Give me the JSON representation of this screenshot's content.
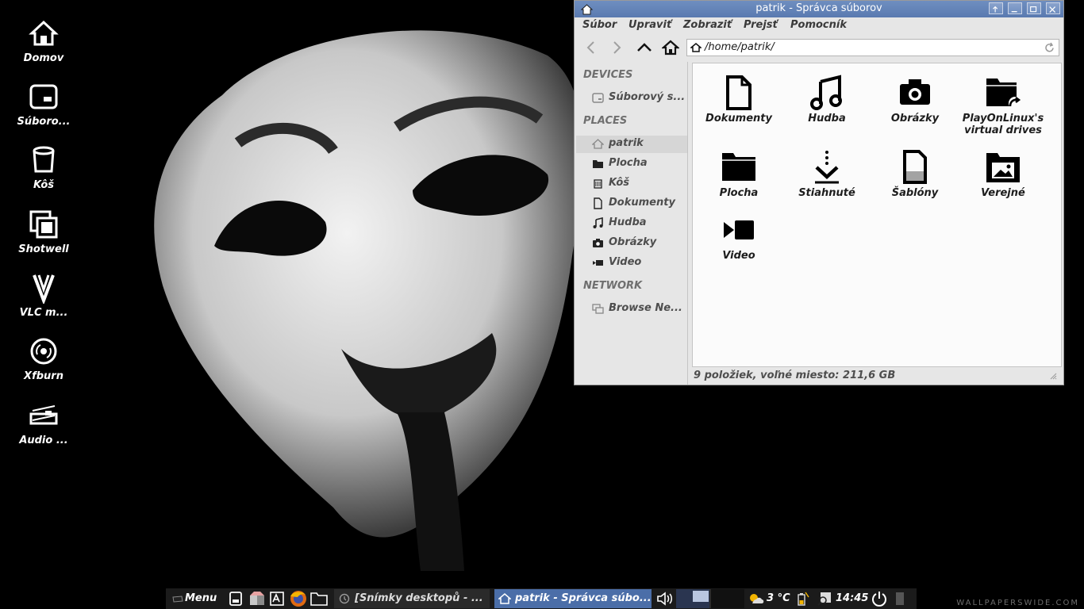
{
  "desktop": {
    "icons": [
      {
        "label": "Domov",
        "icon": "home-icon"
      },
      {
        "label": "Súboro...",
        "icon": "drive-icon"
      },
      {
        "label": "Kôš",
        "icon": "trash-icon"
      },
      {
        "label": "Shotwell",
        "icon": "shotwell-icon"
      },
      {
        "label": "VLC m...",
        "icon": "vlc-icon"
      },
      {
        "label": "Xfburn",
        "icon": "disc-icon"
      },
      {
        "label": "Audio ...",
        "icon": "audio-mixer-icon"
      }
    ]
  },
  "window": {
    "title": "patrik - Správca súborov",
    "menu": [
      "Súbor",
      "Upraviť",
      "Zobraziť",
      "Prejsť",
      "Pomocník"
    ],
    "address": "/home/patrik/",
    "sidebar": {
      "devices_header": "DEVICES",
      "devices": [
        {
          "label": "Súborový s...",
          "icon": "drive-icon"
        }
      ],
      "places_header": "PLACES",
      "places": [
        {
          "label": "patrik",
          "icon": "home-icon"
        },
        {
          "label": "Plocha",
          "icon": "folder-icon"
        },
        {
          "label": "Kôš",
          "icon": "trash-icon"
        },
        {
          "label": "Dokumenty",
          "icon": "document-icon"
        },
        {
          "label": "Hudba",
          "icon": "music-icon"
        },
        {
          "label": "Obrázky",
          "icon": "camera-icon"
        },
        {
          "label": "Video",
          "icon": "video-icon"
        }
      ],
      "network_header": "NETWORK",
      "network": [
        {
          "label": "Browse Ne...",
          "icon": "network-icon"
        }
      ]
    },
    "files": [
      {
        "label": "Dokumenty",
        "icon": "document-icon"
      },
      {
        "label": "Hudba",
        "icon": "music-icon"
      },
      {
        "label": "Obrázky",
        "icon": "camera-icon"
      },
      {
        "label": "PlayOnLinux's virtual drives",
        "icon": "folder-link-icon"
      },
      {
        "label": "Plocha",
        "icon": "folder-icon"
      },
      {
        "label": "Stiahnuté",
        "icon": "download-icon"
      },
      {
        "label": "Šablóny",
        "icon": "template-icon"
      },
      {
        "label": "Verejné",
        "icon": "public-folder-icon"
      },
      {
        "label": "Video",
        "icon": "video-icon"
      }
    ],
    "status": "9 položiek, voľné miesto: 211,6 GB"
  },
  "panel": {
    "menu_label": "Menu",
    "tasks": [
      {
        "label": "[Snímky desktopů - ...",
        "active": false
      },
      {
        "label": "patrik - Správca súbo...",
        "active": true
      }
    ],
    "weather": "3 °C",
    "clock": "14:45"
  },
  "watermark": "WALLPAPERSWIDE.COM"
}
